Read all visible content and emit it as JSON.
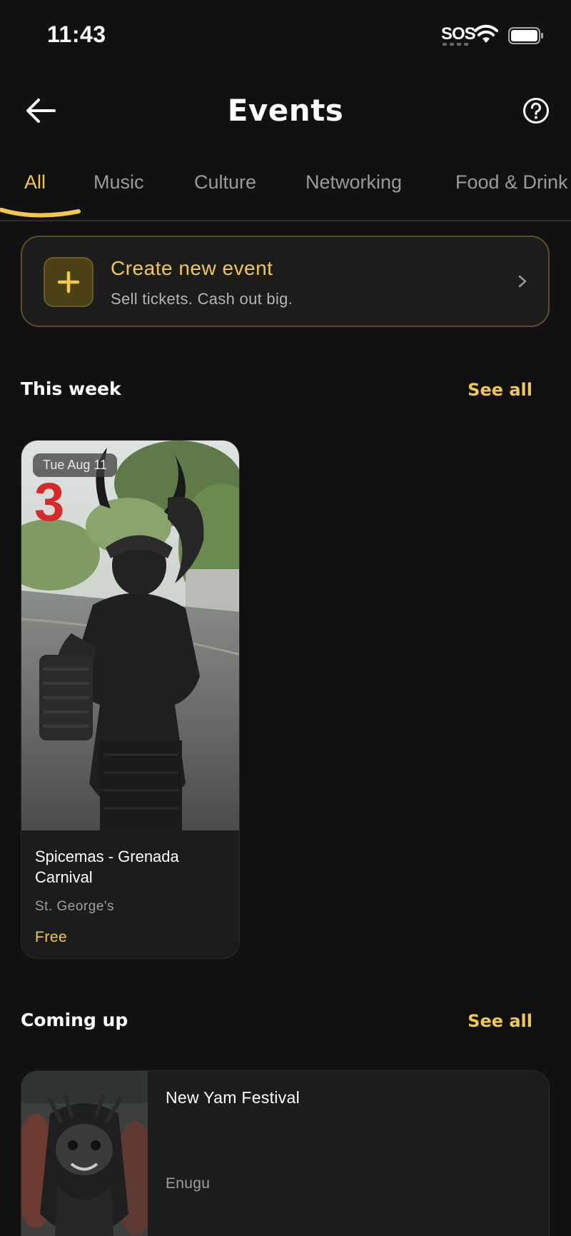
{
  "status_bar": {
    "time": "11:43",
    "sos": "SOS"
  },
  "header": {
    "title": "Events"
  },
  "tabs": [
    {
      "label": "All",
      "active": true
    },
    {
      "label": "Music",
      "active": false
    },
    {
      "label": "Culture",
      "active": false
    },
    {
      "label": "Networking",
      "active": false
    },
    {
      "label": "Food & Drink",
      "active": false
    }
  ],
  "create_card": {
    "title": "Create new event",
    "subtitle": "Sell tickets. Cash out big."
  },
  "this_week": {
    "title": "This week",
    "see_all": "See all",
    "events": [
      {
        "date": "Tue Aug 11",
        "name": "Spicemas - Grenada Carnival",
        "location": "St. George's",
        "price": "Free"
      }
    ]
  },
  "coming_up": {
    "title": "Coming up",
    "see_all": "See all",
    "events": [
      {
        "name": "New Yam Festival",
        "location": "Enugu"
      }
    ]
  },
  "colors": {
    "accent": "#f2c94c",
    "background": "#111111",
    "card": "#1c1c1c"
  }
}
